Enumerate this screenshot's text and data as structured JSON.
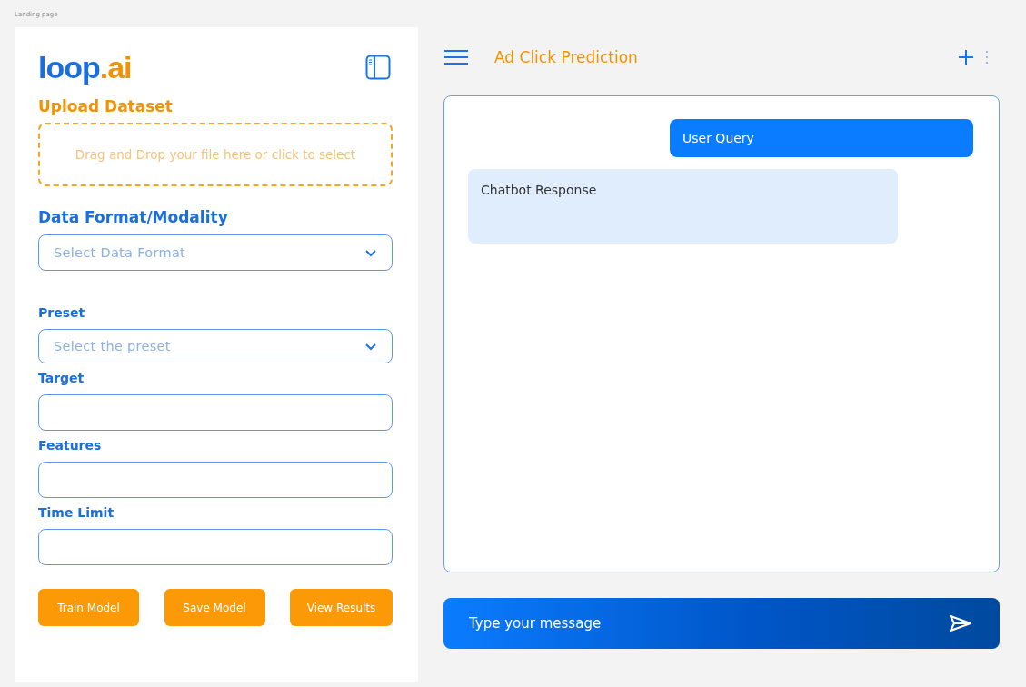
{
  "frame_label": "Landing page",
  "sidebar": {
    "logo": {
      "main": "loop",
      "suffix": ".ai"
    },
    "upload": {
      "heading": "Upload Dataset",
      "dropzone": "Drag and Drop your file here or click to select"
    },
    "fields": [
      {
        "kind": "select",
        "label": "Data Format/Modality",
        "placeholder": "Select Data Format"
      },
      {
        "kind": "select",
        "label": "Preset",
        "placeholder": "Select the preset"
      },
      {
        "kind": "text",
        "label": "Target"
      },
      {
        "kind": "text",
        "label": "Features"
      },
      {
        "kind": "text",
        "label": "Time Limit"
      }
    ],
    "buttons": [
      "Train Model",
      "Save Model",
      "View Results"
    ]
  },
  "chat": {
    "title": "Ad Click Prediction",
    "messages": [
      {
        "kind": "user",
        "text": "User Query"
      },
      {
        "kind": "bot",
        "text": "Chatbot Response"
      }
    ],
    "input": {
      "placeholder": "Type your message"
    }
  }
}
